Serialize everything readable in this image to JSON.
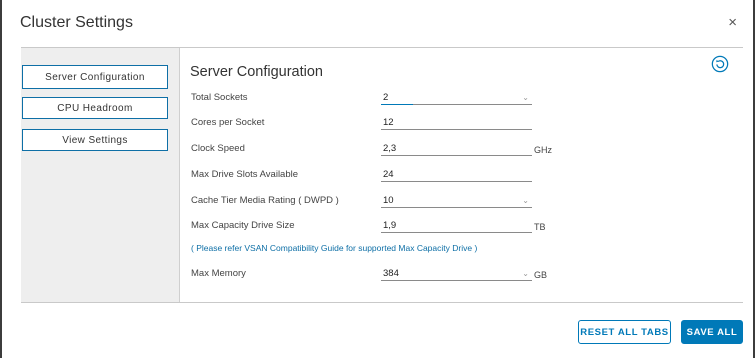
{
  "dialog": {
    "title": "Cluster Settings",
    "close_label": "×"
  },
  "sidebar": {
    "items": [
      {
        "label": "Server Configuration",
        "active": true
      },
      {
        "label": "CPU Headroom",
        "active": false
      },
      {
        "label": "View Settings",
        "active": false
      }
    ]
  },
  "main": {
    "section_title": "Server Configuration",
    "fields": {
      "total_sockets": {
        "label": "Total Sockets",
        "value": "2"
      },
      "cores_per_socket": {
        "label": "Cores per Socket",
        "value": "12"
      },
      "clock_speed": {
        "label": "Clock Speed",
        "value": "2,3",
        "unit": "GHz"
      },
      "max_drive_slots": {
        "label": "Max Drive Slots Available",
        "value": "24"
      },
      "cache_tier_rating": {
        "label": "Cache Tier Media Rating ( DWPD )",
        "value": "10"
      },
      "max_capacity_drive": {
        "label": "Max Capacity Drive Size",
        "value": "1,9",
        "unit": "TB"
      },
      "max_memory": {
        "label": "Max Memory",
        "value": "384",
        "unit": "GB"
      }
    },
    "note": "( Please refer VSAN Compatibility Guide for supported Max Capacity Drive )"
  },
  "footer": {
    "reset_label": "RESET ALL TABS",
    "save_label": "SAVE ALL"
  },
  "colors": {
    "accent": "#0079b8",
    "sidebar_bg": "#eeeeee"
  },
  "icons": {
    "refresh": "refresh-icon",
    "close": "close-icon",
    "chevron": "chevron-down-icon"
  }
}
